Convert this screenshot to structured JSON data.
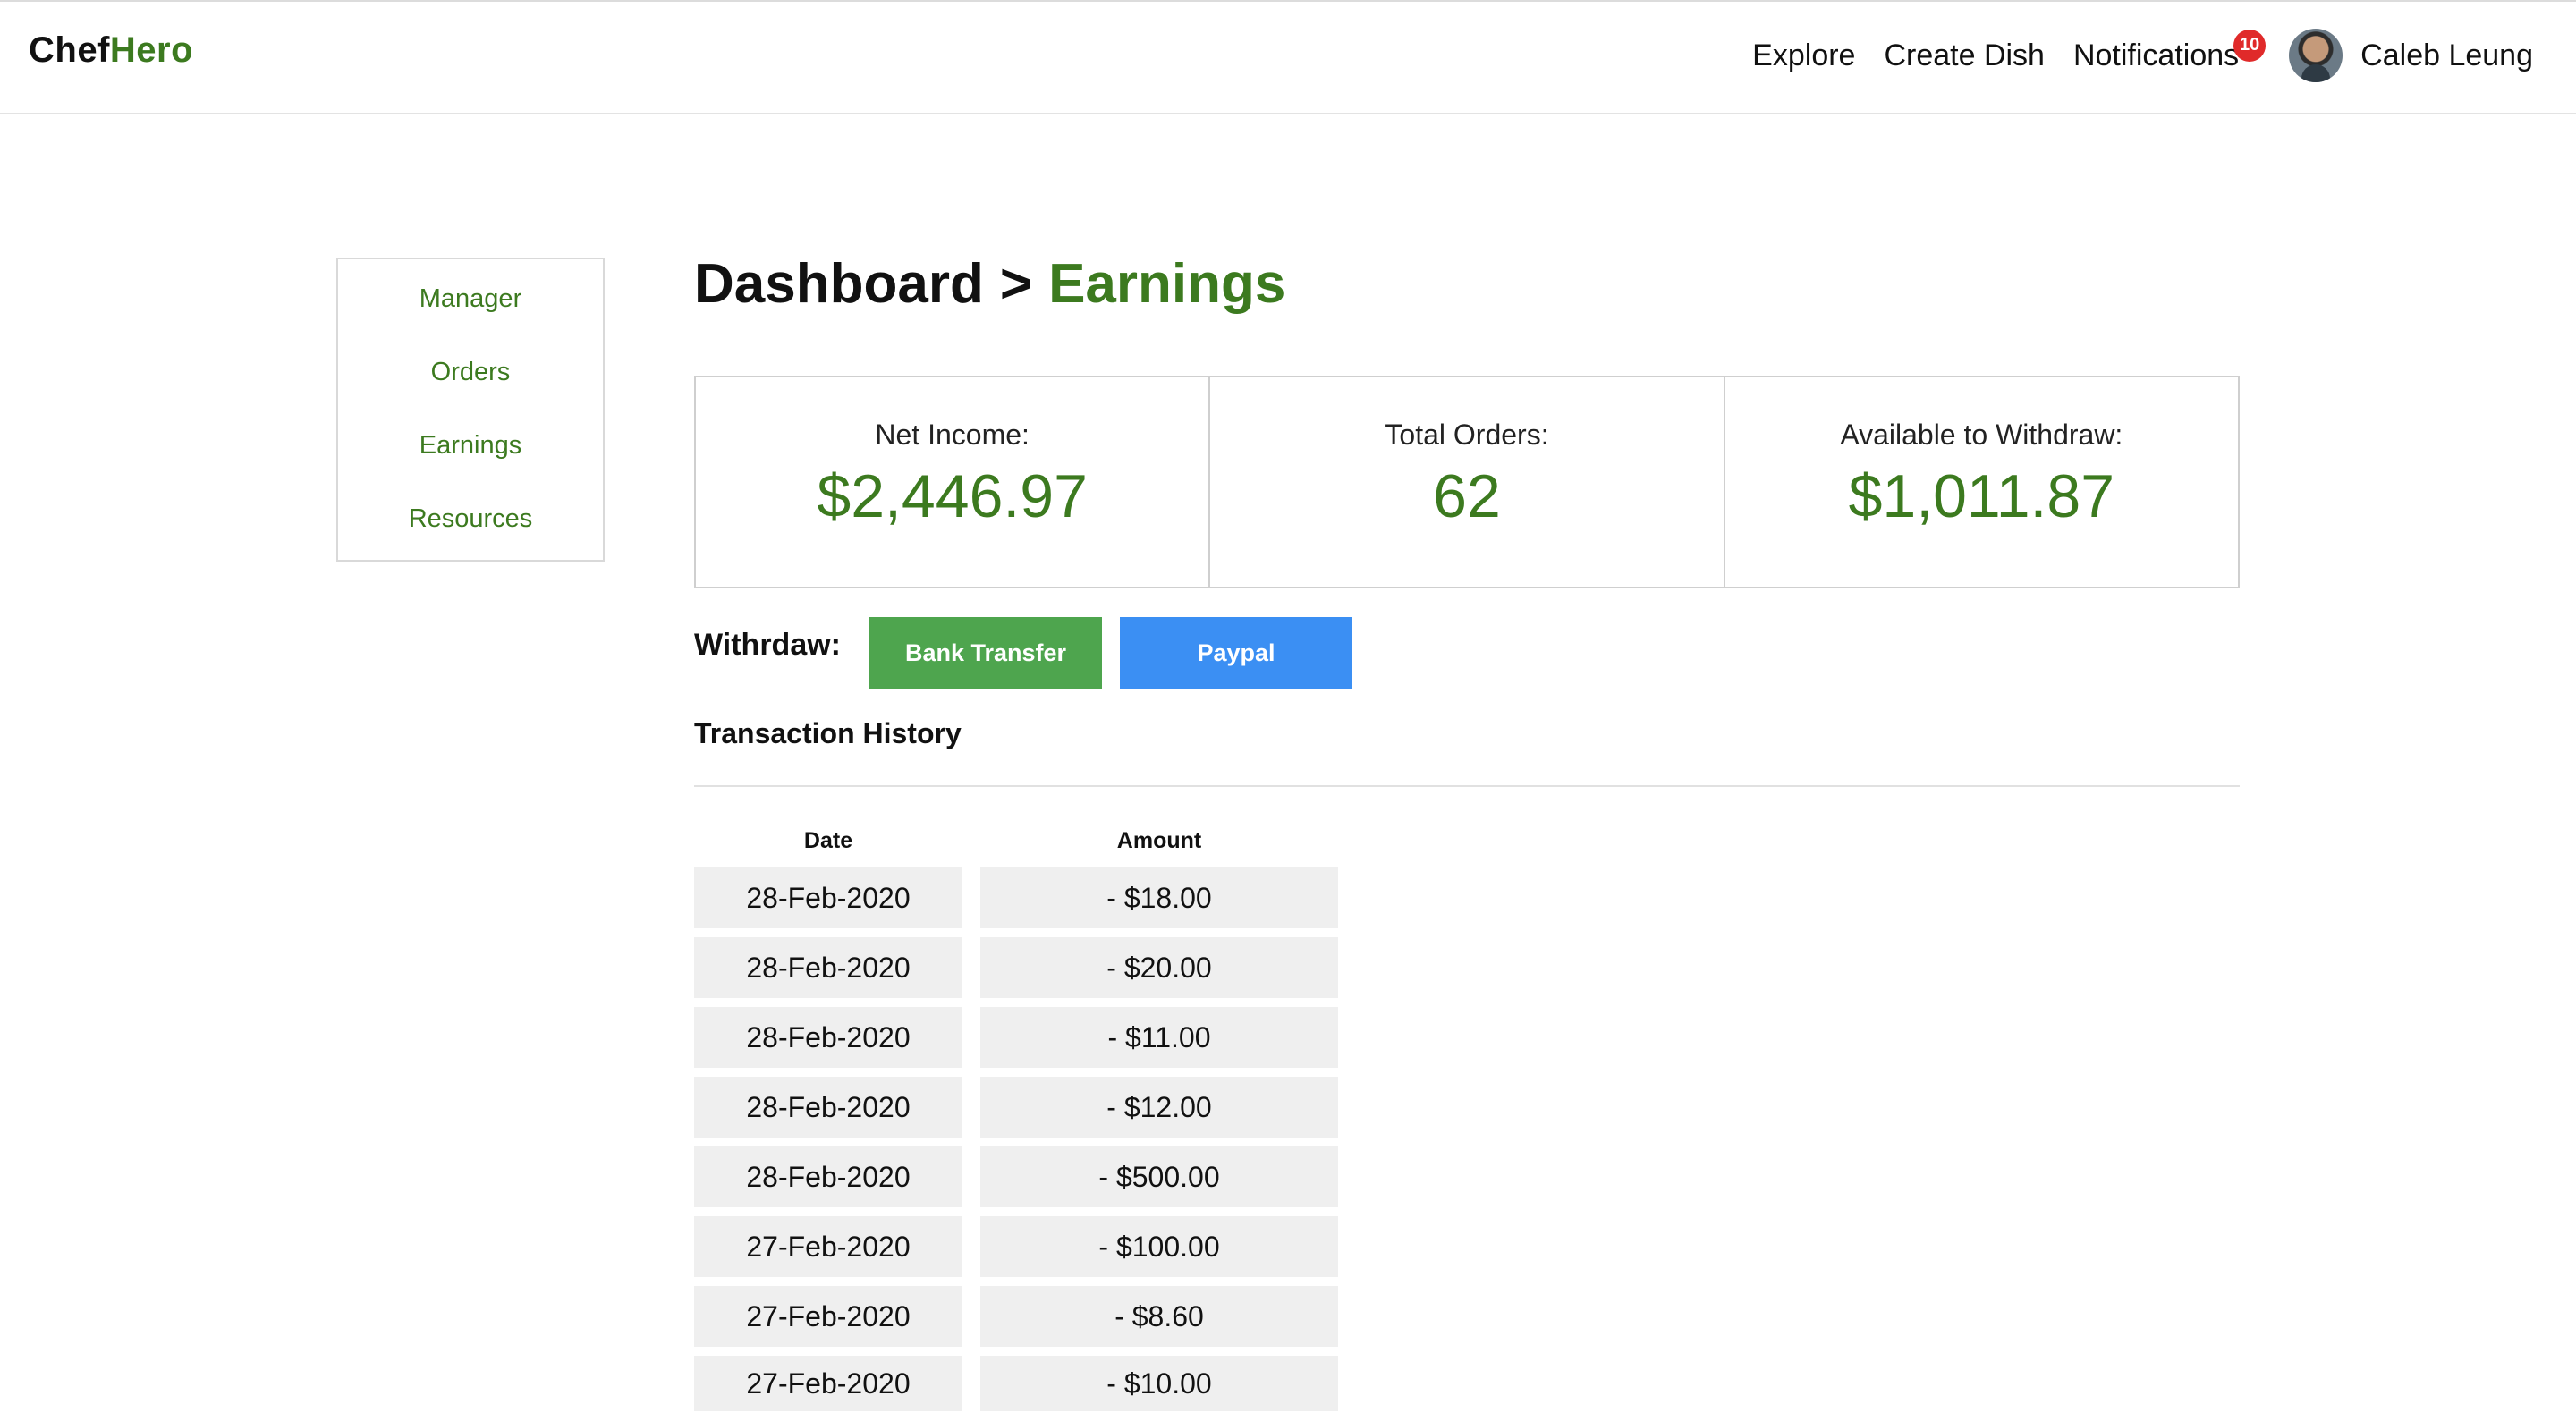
{
  "brand": {
    "part1": "Chef",
    "part2": "Hero"
  },
  "nav": {
    "explore": "Explore",
    "create_dish": "Create Dish",
    "notifications": "Notifications",
    "notification_count": "10",
    "user_name": "Caleb Leung"
  },
  "sidebar": {
    "items": [
      {
        "label": "Manager"
      },
      {
        "label": "Orders"
      },
      {
        "label": "Earnings"
      },
      {
        "label": "Resources"
      }
    ]
  },
  "breadcrumb": {
    "parent": "Dashboard",
    "separator": ">",
    "current": "Earnings"
  },
  "stats": [
    {
      "label": "Net Income:",
      "value": "$2,446.97"
    },
    {
      "label": "Total Orders:",
      "value": "62"
    },
    {
      "label": "Available to Withdraw:",
      "value": "$1,011.87"
    }
  ],
  "withdraw": {
    "label": "Withrdaw:",
    "bank_transfer": "Bank Transfer",
    "paypal": "Paypal"
  },
  "transactions": {
    "title": "Transaction History",
    "columns": {
      "date": "Date",
      "amount": "Amount"
    },
    "rows": [
      {
        "date": "28-Feb-2020",
        "amount": "- $18.00"
      },
      {
        "date": "28-Feb-2020",
        "amount": "- $20.00"
      },
      {
        "date": "28-Feb-2020",
        "amount": "- $11.00"
      },
      {
        "date": "28-Feb-2020",
        "amount": "- $12.00"
      },
      {
        "date": "28-Feb-2020",
        "amount": "- $500.00"
      },
      {
        "date": "27-Feb-2020",
        "amount": "- $100.00"
      },
      {
        "date": "27-Feb-2020",
        "amount": "- $8.60"
      },
      {
        "date": "27-Feb-2020",
        "amount": "- $10.00"
      }
    ]
  },
  "colors": {
    "brand_green": "#3c7a1f",
    "bank_button": "#4ea54e",
    "paypal_button": "#3b8ff3",
    "badge_red": "#e02a2a",
    "cell_bg": "#efefef"
  }
}
